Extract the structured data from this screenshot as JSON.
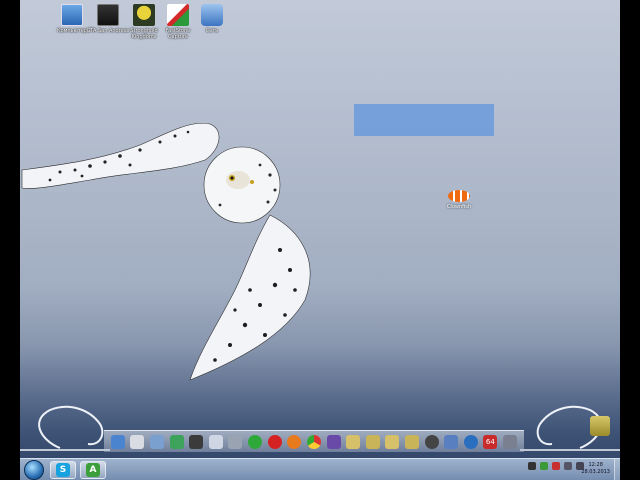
{
  "desktop_icons": [
    {
      "label": "Компьютер",
      "icon": "computer-icon"
    },
    {
      "label": "GTA San Andreas",
      "icon": "gta-icon"
    },
    {
      "label": "Stronghold Kingdoms",
      "icon": "stronghold-icon"
    },
    {
      "label": "FastStone Capture",
      "icon": "fraps-icon"
    },
    {
      "label": "Сеть",
      "icon": "network-icon"
    }
  ],
  "clownfish": {
    "label": "Clownfish"
  },
  "taskbar": {
    "time": "12:28",
    "date": "28.03.2013",
    "pinned": [
      "skype",
      "android"
    ]
  },
  "dock_items": [
    "computer",
    "docs",
    "folder",
    "sheet",
    "video",
    "doc",
    "settings",
    "opera",
    "firefox",
    "chrome",
    "media",
    "folder",
    "folder",
    "folder",
    "folder",
    "safari",
    "network",
    "shield",
    "download",
    "64",
    "tools"
  ],
  "colors": {
    "accent": "#2b6fb5",
    "selection": "#6096dc"
  }
}
